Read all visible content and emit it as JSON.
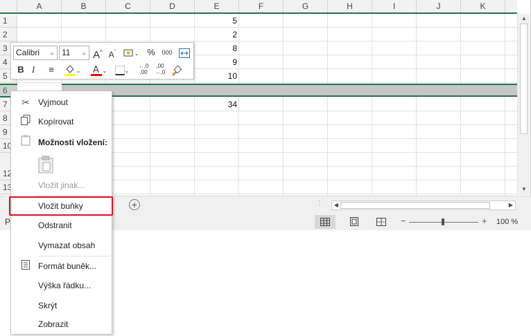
{
  "columns": [
    "A",
    "B",
    "C",
    "D",
    "E",
    "F",
    "G",
    "H",
    "I",
    "J",
    "K"
  ],
  "rows": [
    "1",
    "2",
    "3",
    "4",
    "5",
    "6",
    "7",
    "8",
    "9",
    "10",
    "12",
    "13"
  ],
  "cells": {
    "E1": "5",
    "E2": "2",
    "E3": "8",
    "E4": "9",
    "E5": "10",
    "E7": "34"
  },
  "mini_toolbar": {
    "font_name": "Calibri",
    "font_size": "11",
    "grow_font": "A^",
    "shrink_font": "A˅",
    "percent": "%",
    "thousands": "000",
    "bold": "B",
    "italic": "I",
    "fill_color": "#ffff00",
    "font_color": "#ff0000",
    "increase_decimal": "←,0 ,00",
    "decrease_decimal": ",00 →,0"
  },
  "context_menu": {
    "cut": "Vyjmout",
    "copy": "Kopírovat",
    "paste_options": "Možnosti vložení:",
    "paste_special": "Vložit jinak...",
    "insert_cells": "Vložit buňky",
    "delete": "Odstranit",
    "clear_contents": "Vymazat obsah",
    "format_cells": "Formát buněk...",
    "row_height": "Výška řádku...",
    "hide": "Skrýt",
    "unhide": "Zobrazit"
  },
  "status_bar": {
    "left_text": "P",
    "zoom_minus": "−",
    "zoom_plus": "+",
    "zoom_level": "100 %",
    "zoom_value": 100
  },
  "accent_colors": {
    "excel_green": "#217346",
    "highlight_red": "#e0101a"
  }
}
